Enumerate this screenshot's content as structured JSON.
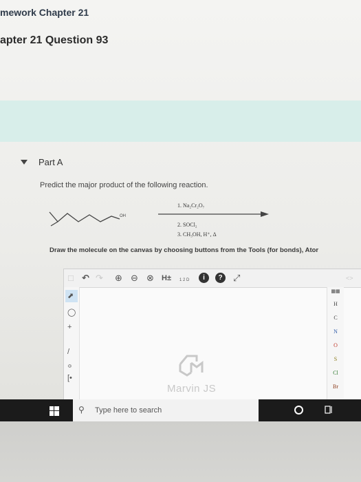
{
  "breadcrumb": "mework Chapter 21",
  "question_title": "apter 21 Question 93",
  "part": {
    "label": "Part A"
  },
  "problem": {
    "prompt": "Predict the major product of the following reaction.",
    "oh_label": "OH",
    "conditions": [
      "1. Na₂Cr₂O₇",
      "2. SOCl₂",
      "3. CH₃OH, H⁺, Δ"
    ]
  },
  "instructions": "Draw the molecule on the canvas by choosing buttons from the Tools (for bonds), Ator",
  "editor": {
    "toolbar": {
      "hydrogen_label": "H±",
      "numbering_label": "1 2 D"
    },
    "left_tools": [
      "select-tool",
      "erase-tool",
      "plus-charge",
      "bond-tool",
      "chain-tool",
      "bracket-tool"
    ],
    "elements": [
      "H",
      "C",
      "N",
      "O",
      "S",
      "Cl",
      "Br"
    ],
    "watermark": "Marvin JS"
  },
  "taskbar": {
    "search_placeholder": "Type here to search"
  },
  "colors": {
    "accent_band": "#d8eeea",
    "taskbar": "#1b1b1b"
  }
}
